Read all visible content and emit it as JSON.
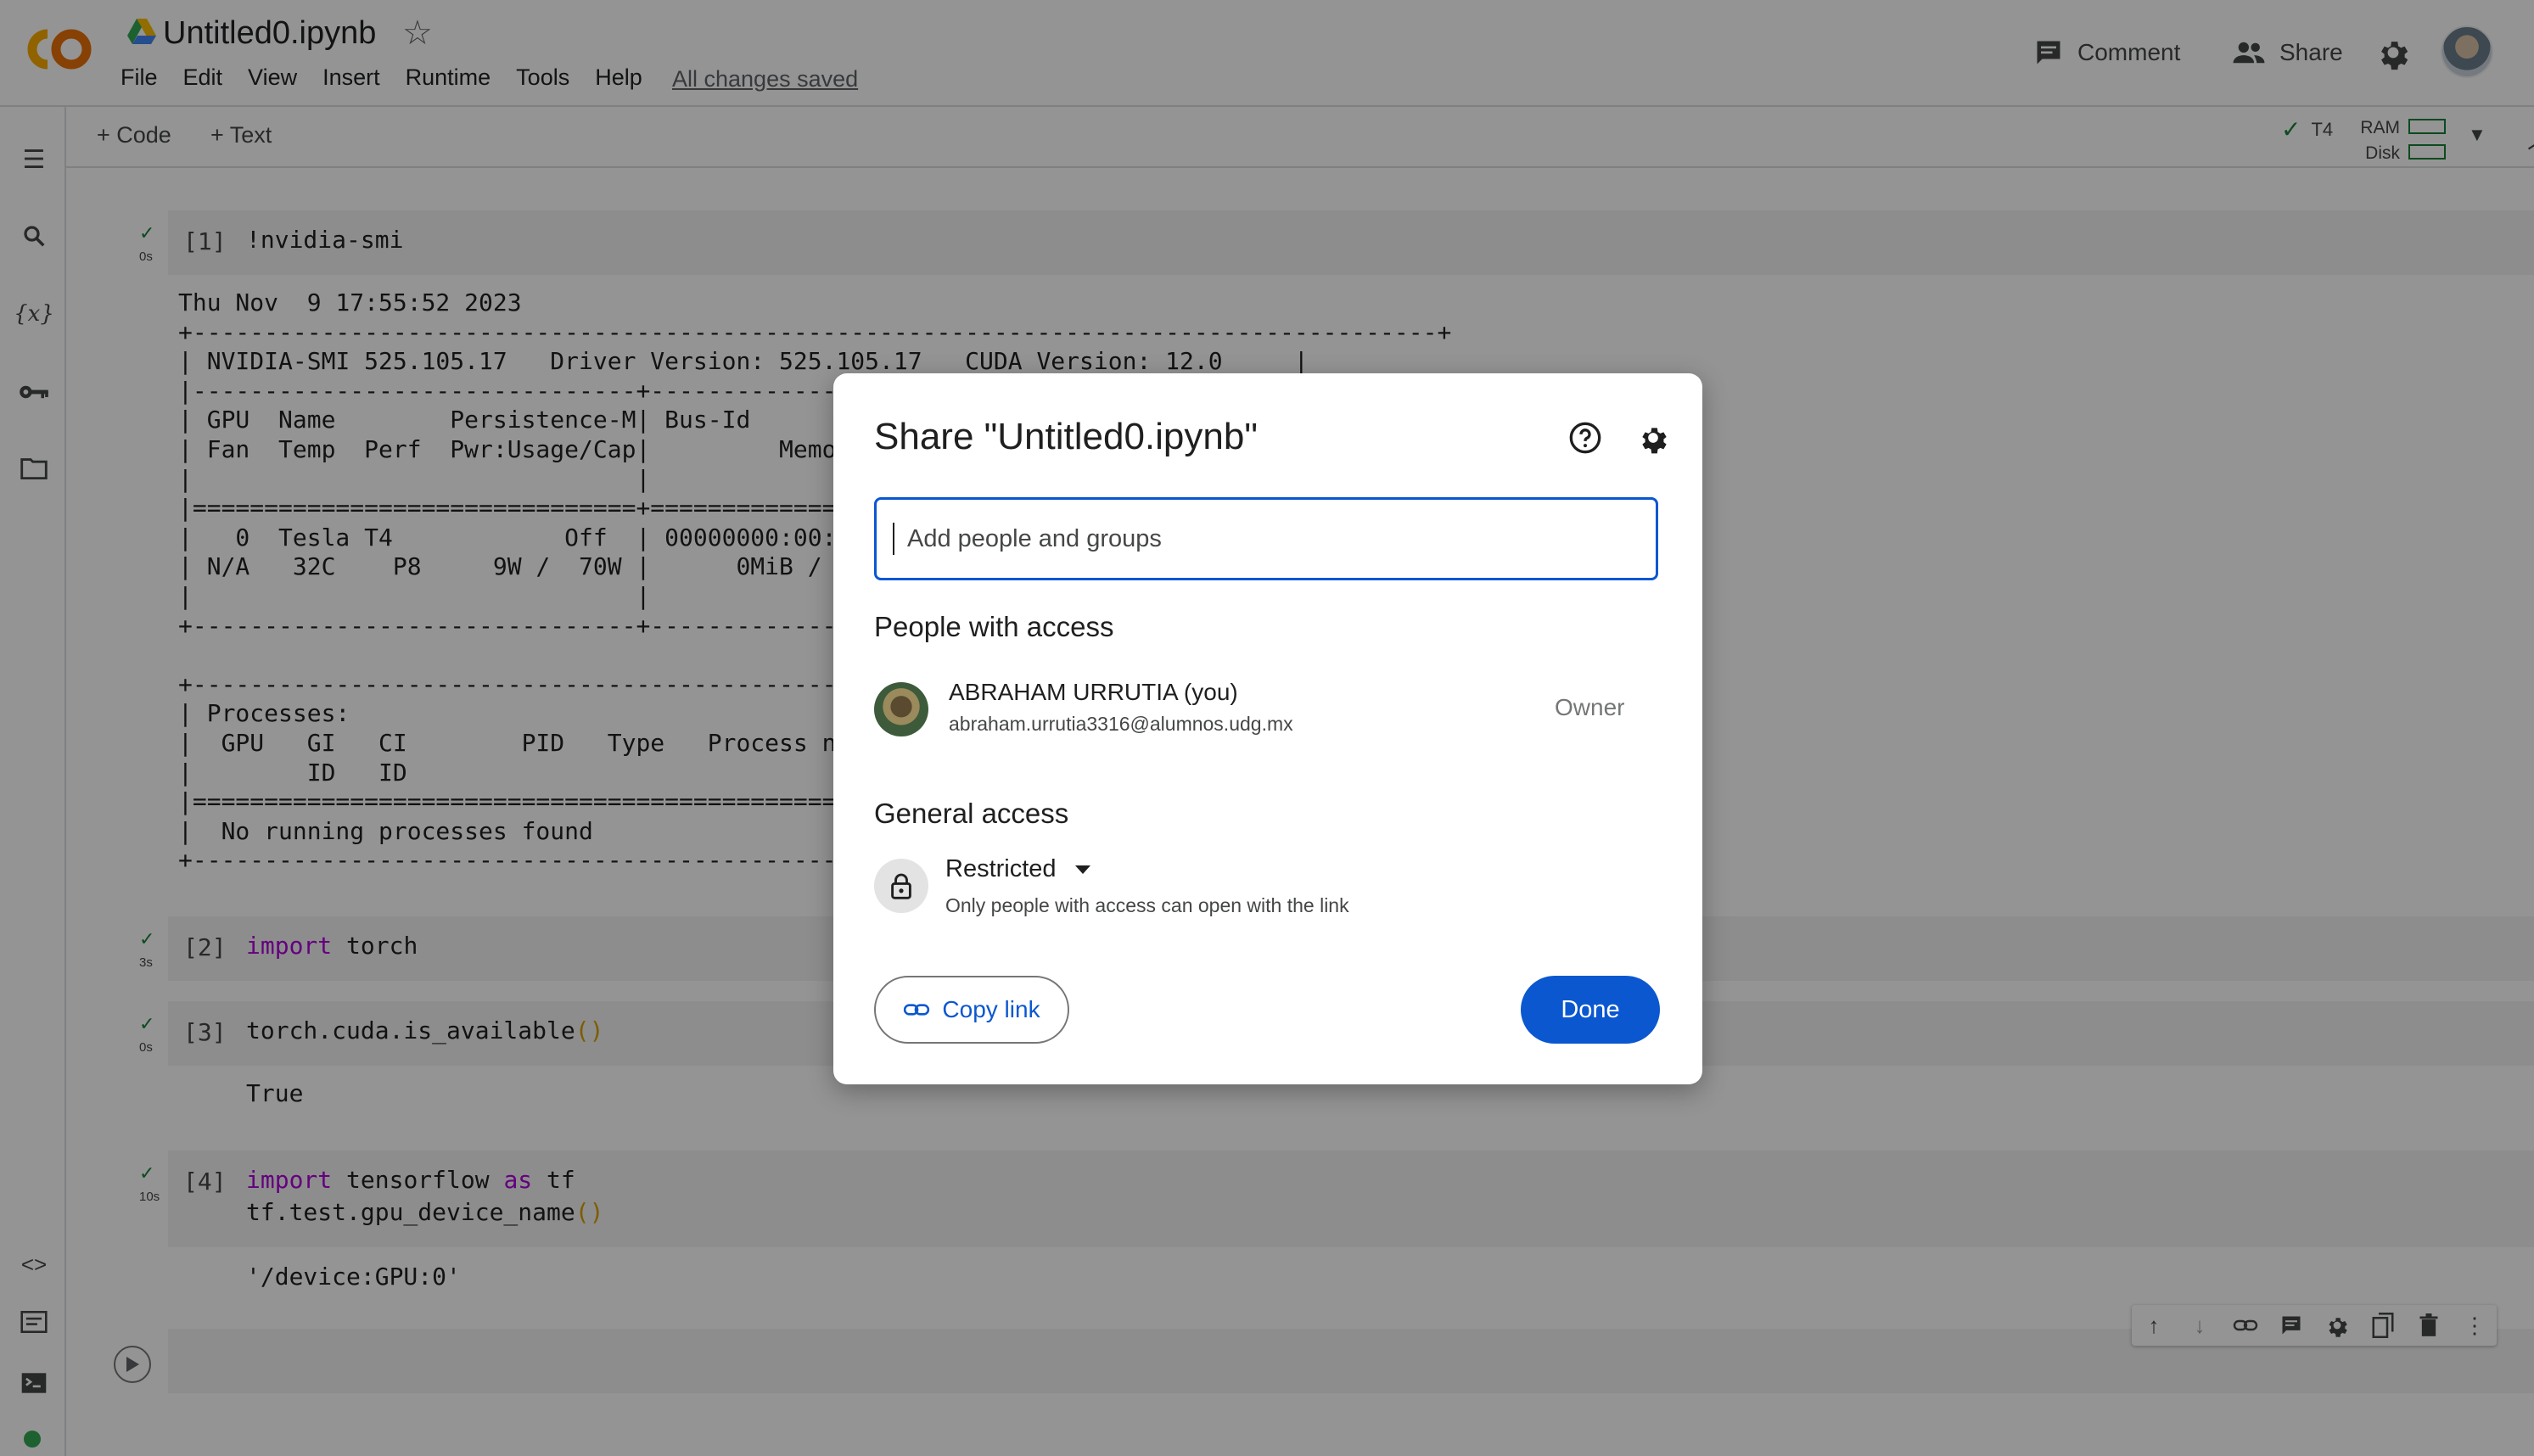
{
  "header": {
    "notebook_title": "Untitled0.ipynb",
    "menu": [
      "File",
      "Edit",
      "View",
      "Insert",
      "Runtime",
      "Tools",
      "Help"
    ],
    "save_status": "All changes saved",
    "comment_label": "Comment",
    "share_label": "Share"
  },
  "toolbar": {
    "code_label": "+ Code",
    "text_label": "+ Text",
    "runtime_label": "T4",
    "ram_label": "RAM",
    "disk_label": "Disk"
  },
  "cells": [
    {
      "number": "[1]",
      "time": "0s",
      "code": "!nvidia-smi"
    },
    {
      "number": "[2]",
      "time": "3s",
      "kw": "import",
      "rest": " torch"
    },
    {
      "number": "[3]",
      "time": "0s",
      "code": "torch.cuda.is_available",
      "parens": "()",
      "output": "True"
    },
    {
      "number": "[4]",
      "time": "10s",
      "line1_kw": "import",
      "line1_mid": " tensorflow ",
      "line1_kw2": "as",
      "line1_end": " tf",
      "line2": "tf.test.gpu_device_name",
      "line2_parens": "()",
      "output": "'/device:GPU:0'"
    }
  ],
  "nvidia_smi_output": "Thu Nov  9 17:55:52 2023\n+---------------------------------------------------------------------------------------+\n| NVIDIA-SMI 525.105.17   Driver Version: 525.105.17   CUDA Version: 12.0     |\n|-------------------------------+----------------------+----------------------+\n| GPU  Name        Persistence-M| Bus-Id        Disp.A | Volatile Uncorr. ECC |\n| Fan  Temp  Perf  Pwr:Usage/Cap|         Memory-Usage | GPU-Util  Compute M. |\n|                               |                      |               MIG M. |\n|===============================+======================+======================|\n|   0  Tesla T4            Off  | 00000000:00:04.0 Off |                    0 |\n| N/A   32C    P8     9W /  70W |      0MiB / 15360MiB |      0%      Default |\n|                               |                      |                  N/A |\n+-------------------------------+----------------------+----------------------+\n\n+-----------------------------------------------------------------------------+\n| Processes:                                                                  |\n|  GPU   GI   CI        PID   Type   Process name                  GPU Memory |\n|        ID   ID                                                   Usage      |\n|=============================================================================|\n|  No running processes found                                                 |\n+-----------------------------------------------------------------------------+",
  "share_dialog": {
    "title": "Share \"Untitled0.ipynb\"",
    "input_placeholder": "Add people and groups",
    "people_heading": "People with access",
    "user_name": "ABRAHAM URRUTIA (you)",
    "user_email": "abraham.urrutia3316@alumnos.udg.mx",
    "user_role": "Owner",
    "general_heading": "General access",
    "access_level": "Restricted",
    "access_desc": "Only people with access can open with the link",
    "copy_link": "Copy link",
    "done": "Done"
  },
  "colors": {
    "primary": "#0b57d0",
    "check": "#188038",
    "keyword": "#af00db"
  }
}
